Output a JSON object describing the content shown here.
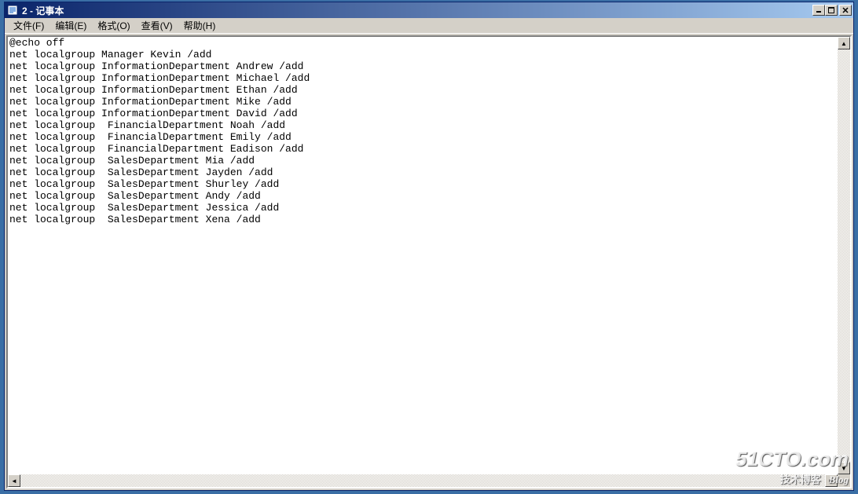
{
  "title": "2 - 记事本",
  "menu": {
    "file": "文件(F)",
    "edit": "编辑(E)",
    "format": "格式(O)",
    "view": "查看(V)",
    "help": "帮助(H)"
  },
  "content": "@echo off\nnet localgroup Manager Kevin /add\nnet localgroup InformationDepartment Andrew /add\nnet localgroup InformationDepartment Michael /add\nnet localgroup InformationDepartment Ethan /add\nnet localgroup InformationDepartment Mike /add\nnet localgroup InformationDepartment David /add\nnet localgroup  FinancialDepartment Noah /add\nnet localgroup  FinancialDepartment Emily /add\nnet localgroup  FinancialDepartment Eadison /add\nnet localgroup  SalesDepartment Mia /add\nnet localgroup  SalesDepartment Jayden /add\nnet localgroup  SalesDepartment Shurley /add\nnet localgroup  SalesDepartment Andy /add\nnet localgroup  SalesDepartment Jessica /add\nnet localgroup  SalesDepartment Xena /add",
  "watermark": {
    "main": "51CTO.com",
    "sub": "技术博客",
    "blog": "Blog"
  },
  "arrows": {
    "left": "◄",
    "right": "►",
    "up": "▲",
    "down": "▼"
  }
}
